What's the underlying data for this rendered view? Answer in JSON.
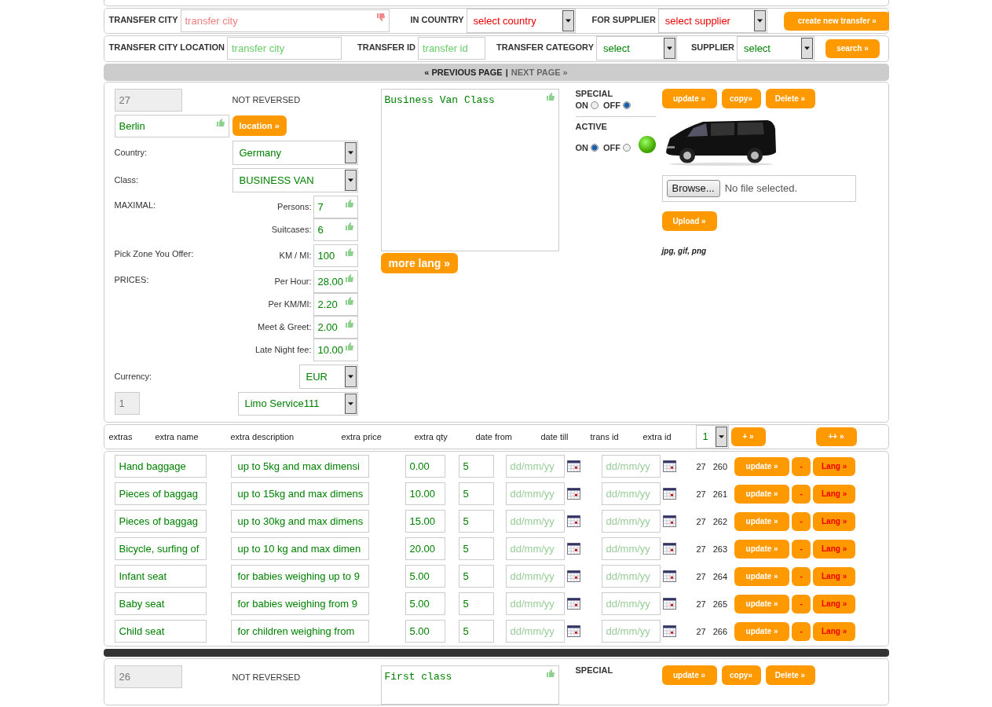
{
  "top_filters": {
    "transfer_city": {
      "label": "TRANSFER CITY",
      "placeholder": "transfer city",
      "valid": false
    },
    "in_country": {
      "label": "IN COUNTRY",
      "value": "select country",
      "valid": false
    },
    "for_supplier": {
      "label": "FOR SUPPLIER",
      "value": "select supplier",
      "valid": false
    },
    "create_button": "create new transfer »"
  },
  "search_filters": {
    "location": {
      "label": "TRANSFER CITY LOCATION",
      "placeholder": "transfer city",
      "valid": true
    },
    "transfer_id": {
      "label": "TRANSFER ID",
      "placeholder": "transfer id",
      "valid": true
    },
    "category": {
      "label": "TRANSFER CATEGORY",
      "value": "select",
      "valid": true
    },
    "supplier": {
      "label": "SUPPLIER",
      "value": "select",
      "valid": true
    },
    "search_button": "search »"
  },
  "pager": {
    "previous": {
      "label": "« PREVIOUS PAGE",
      "disabled": false
    },
    "separator": "|",
    "next": {
      "label": "NEXT PAGE »",
      "disabled": true
    }
  },
  "transfer": {
    "id": "27",
    "reversed": "NOT REVERSED",
    "city": {
      "value": "Berlin",
      "valid": true
    },
    "location_button": "location »",
    "country": {
      "label": "Country:",
      "value": "Germany"
    },
    "class": {
      "label": "Class:",
      "value": "BUSINESS VAN"
    },
    "maximal": {
      "label": "MAXIMAL:",
      "fields": [
        {
          "label": "Persons:",
          "value": "7",
          "valid": true
        },
        {
          "label": "Suitcases:",
          "value": "6",
          "valid": true
        }
      ]
    },
    "pick_zone": {
      "label": "Pick Zone You Offer:",
      "fields": [
        {
          "label": "KM / MI:",
          "value": "100",
          "valid": true
        }
      ]
    },
    "prices": {
      "label": "PRICES:",
      "fields": [
        {
          "label": "Per Hour:",
          "value": "28.00",
          "valid": true
        },
        {
          "label": "Per KM/MI:",
          "value": "2.20",
          "valid": true
        },
        {
          "label": "Meet & Greet:",
          "value": "2.00",
          "valid": true
        },
        {
          "label": "Late Night fee:",
          "value": "10.00",
          "valid": true
        }
      ]
    },
    "currency": {
      "label": "Currency:",
      "value": "EUR"
    },
    "supplier_id": "1",
    "supplier": "Limo Service111",
    "description": {
      "value": "Business Van Class",
      "valid": true
    },
    "more_lang_button": "more lang »",
    "special": {
      "label": "SPECIAL",
      "options": [
        {
          "label": "ON",
          "selected": false
        },
        {
          "label": "OFF",
          "selected": true
        }
      ]
    },
    "active": {
      "label": "ACTIVE",
      "options": [
        {
          "label": "ON",
          "selected": true
        },
        {
          "label": "OFF",
          "selected": false
        }
      ],
      "on": true
    },
    "actions": [
      {
        "kind": "update",
        "label": "update »"
      },
      {
        "kind": "copy",
        "label": "copy»"
      },
      {
        "kind": "delete",
        "label": "Delete »"
      }
    ],
    "browse_button": "Browse...",
    "file_status": "No file selected.",
    "upload_button": "Upload »",
    "file_types": "jpg, gif, png"
  },
  "extras_header": {
    "columns": [
      "extras",
      "extra name",
      "extra description",
      "extra price",
      "extra qty",
      "date from",
      "date till",
      "trans id",
      "extra id"
    ],
    "qty_select": "1",
    "add_button": "+ »",
    "add_many_button": "++ »"
  },
  "extras": [
    {
      "name": "Hand baggage",
      "description": "up to 5kg and max dimensi",
      "price": "0.00",
      "qty": "5",
      "date_from": "dd/mm/yy",
      "date_till": "dd/mm/yy",
      "trans_id": "27",
      "extra_id": "260",
      "actions": [
        {
          "kind": "update",
          "label": "update »"
        },
        {
          "kind": "remove",
          "label": "-"
        },
        {
          "kind": "lang",
          "label": "Lang »"
        }
      ]
    },
    {
      "name": "Pieces of baggag",
      "description": "up to 15kg and max dimens",
      "price": "10.00",
      "qty": "5",
      "date_from": "dd/mm/yy",
      "date_till": "dd/mm/yy",
      "trans_id": "27",
      "extra_id": "261",
      "actions": [
        {
          "kind": "update",
          "label": "update »"
        },
        {
          "kind": "remove",
          "label": "-"
        },
        {
          "kind": "lang",
          "label": "Lang »"
        }
      ]
    },
    {
      "name": "Pieces of baggag",
      "description": "up to 30kg and max dimens",
      "price": "15.00",
      "qty": "5",
      "date_from": "dd/mm/yy",
      "date_till": "dd/mm/yy",
      "trans_id": "27",
      "extra_id": "262",
      "actions": [
        {
          "kind": "update",
          "label": "update »"
        },
        {
          "kind": "remove",
          "label": "-"
        },
        {
          "kind": "lang",
          "label": "Lang »"
        }
      ]
    },
    {
      "name": "Bicycle, surfing of",
      "description": "up to 10 kg and max dimen",
      "price": "20.00",
      "qty": "5",
      "date_from": "dd/mm/yy",
      "date_till": "dd/mm/yy",
      "trans_id": "27",
      "extra_id": "263",
      "actions": [
        {
          "kind": "update",
          "label": "update »"
        },
        {
          "kind": "remove",
          "label": "-"
        },
        {
          "kind": "lang",
          "label": "Lang »"
        }
      ]
    },
    {
      "name": "Infant seat",
      "description": "for babies weighing up to 9",
      "price": "5.00",
      "qty": "5",
      "date_from": "dd/mm/yy",
      "date_till": "dd/mm/yy",
      "trans_id": "27",
      "extra_id": "264",
      "actions": [
        {
          "kind": "update",
          "label": "update »"
        },
        {
          "kind": "remove",
          "label": "-"
        },
        {
          "kind": "lang",
          "label": "Lang »"
        }
      ]
    },
    {
      "name": "Baby seat",
      "description": "for babies weighing from 9",
      "price": "5.00",
      "qty": "5",
      "date_from": "dd/mm/yy",
      "date_till": "dd/mm/yy",
      "trans_id": "27",
      "extra_id": "265",
      "actions": [
        {
          "kind": "update",
          "label": "update »"
        },
        {
          "kind": "remove",
          "label": "-"
        },
        {
          "kind": "lang",
          "label": "Lang »"
        }
      ]
    },
    {
      "name": "Child seat",
      "description": "for children weighing from",
      "price": "5.00",
      "qty": "5",
      "date_from": "dd/mm/yy",
      "date_till": "dd/mm/yy",
      "trans_id": "27",
      "extra_id": "266",
      "actions": [
        {
          "kind": "update",
          "label": "update »"
        },
        {
          "kind": "remove",
          "label": "-"
        },
        {
          "kind": "lang",
          "label": "Lang »"
        }
      ]
    }
  ],
  "next_transfer": {
    "id": "26",
    "reversed": "NOT REVERSED",
    "description": {
      "value": "First class",
      "valid": true
    },
    "special_label": "SPECIAL",
    "actions": [
      {
        "kind": "update",
        "label": "update »"
      },
      {
        "kind": "copy",
        "label": "copy»"
      },
      {
        "kind": "delete",
        "label": "Delete »"
      }
    ]
  }
}
